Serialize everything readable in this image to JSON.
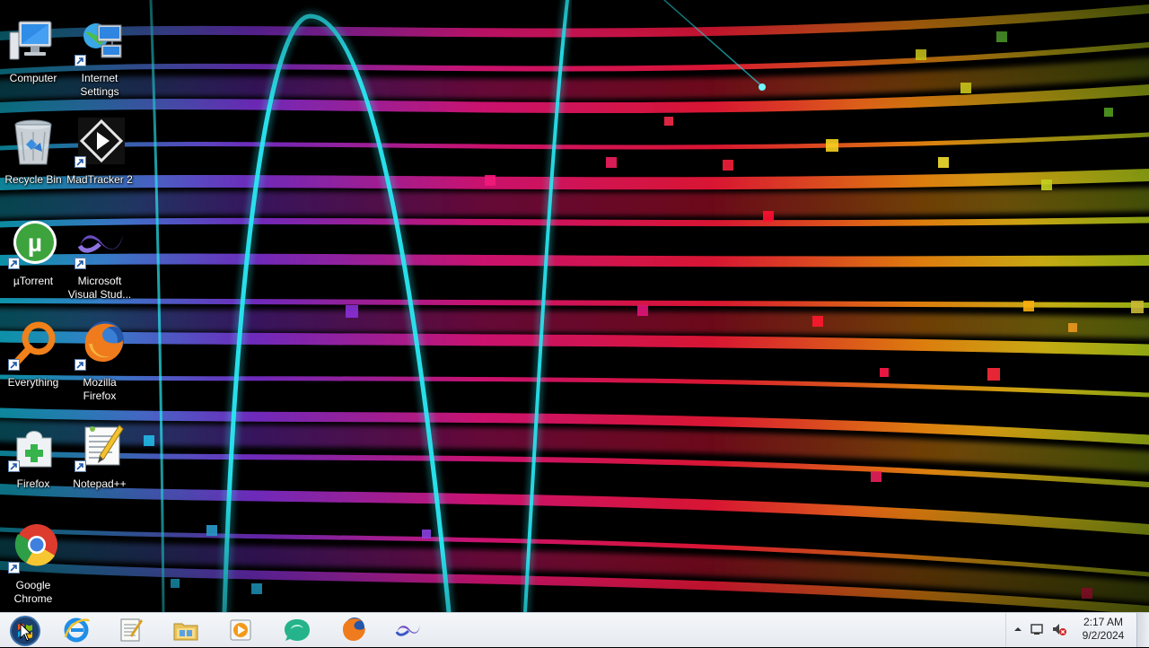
{
  "desktop": {
    "icons": [
      {
        "label": "Computer",
        "icon": "computer-icon",
        "shortcut": false
      },
      {
        "label": "Internet Settings",
        "icon": "internet-settings-icon",
        "shortcut": true
      },
      {
        "label": "Recycle Bin",
        "icon": "recycle-bin-icon",
        "shortcut": false
      },
      {
        "label": "MadTracker 2",
        "icon": "madtracker-icon",
        "shortcut": true
      },
      {
        "label": "µTorrent",
        "icon": "utorrent-icon",
        "shortcut": true
      },
      {
        "label": "Microsoft Visual Stud...",
        "icon": "visual-studio-icon",
        "shortcut": true
      },
      {
        "label": "Everything",
        "icon": "everything-search-icon",
        "shortcut": true
      },
      {
        "label": "Mozilla Firefox",
        "icon": "firefox-icon",
        "shortcut": true
      },
      {
        "label": "Firefox",
        "icon": "firefox-portable-icon",
        "shortcut": true
      },
      {
        "label": "Notepad++",
        "icon": "notepad-plus-plus-icon",
        "shortcut": true
      },
      {
        "label": "Google Chrome",
        "icon": "chrome-icon",
        "shortcut": true
      }
    ]
  },
  "taskbar": {
    "pinned": [
      {
        "name": "Internet Explorer",
        "icon": "internet-explorer-icon"
      },
      {
        "name": "Notepad",
        "icon": "notepad-icon"
      },
      {
        "name": "Windows Explorer",
        "icon": "folder-icon"
      },
      {
        "name": "Media Player",
        "icon": "media-player-icon"
      },
      {
        "name": "Chat",
        "icon": "chat-bubble-icon"
      },
      {
        "name": "Mozilla Firefox",
        "icon": "firefox-icon"
      },
      {
        "name": "Microsoft Visual Studio",
        "icon": "visual-studio-icon"
      }
    ],
    "tray": {
      "icons": [
        "show-hidden-icons-chevron",
        "action-center-flag-icon",
        "volume-muted-icon"
      ],
      "time": "2:17 AM",
      "date": "9/2/2024"
    }
  },
  "colors": {
    "taskbar_bg": "#eef1f5",
    "label_text": "#ffffff"
  }
}
